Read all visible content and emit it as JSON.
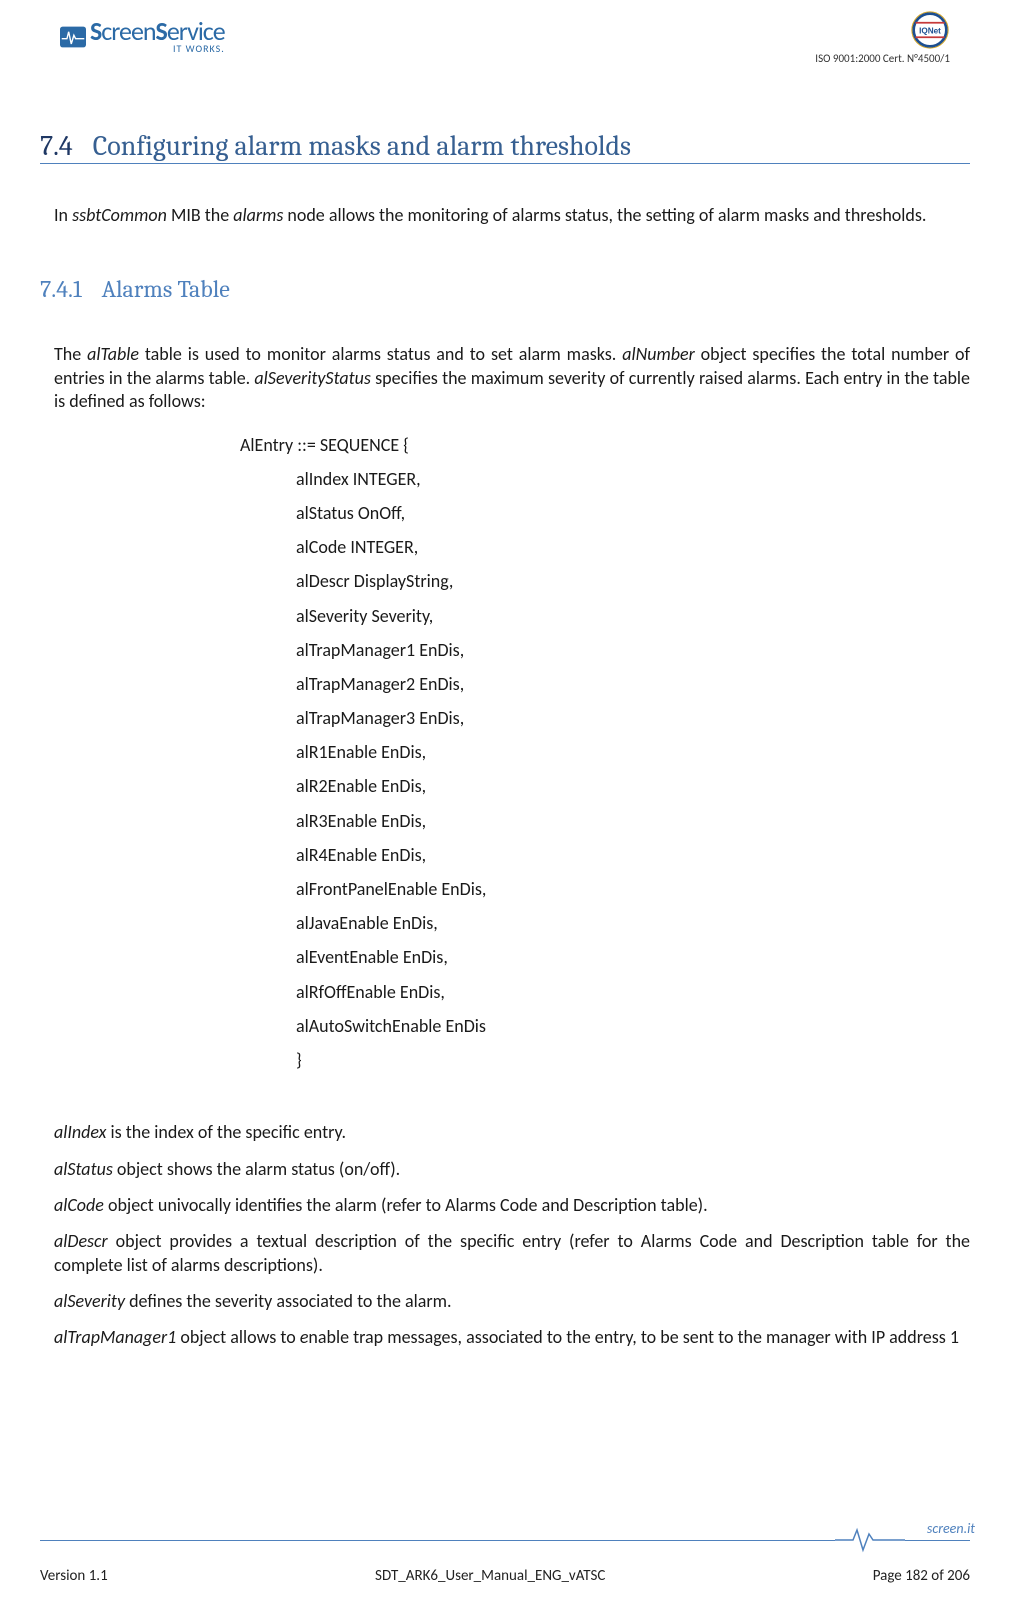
{
  "header": {
    "company_logo_main": "ScreenService",
    "company_logo_sub": "IT WORKS.",
    "cert_line": "ISO 9001:2000 Cert. N°4500/1",
    "iqnet_label": "IQNet"
  },
  "section": {
    "num_7_4": "7.4",
    "title_7_4": "Configuring alarm masks and alarm thresholds",
    "num_7_4_1": "7.4.1",
    "title_7_4_1": "Alarms Table"
  },
  "paragraphs": {
    "p1_pre": "In ",
    "p1_i1": "ssbtCommon",
    "p1_mid1": " MIB the ",
    "p1_i2": "alarms",
    "p1_post": " node allows the monitoring of alarms status, the setting of alarm masks and thresholds.",
    "p2_pre": "The ",
    "p2_i1": "alTable",
    "p2_mid1": " table is used to monitor alarms status and to set alarm masks. ",
    "p2_i2": "alNumber",
    "p2_mid2": " object specifies the total number of entries in the alarms table. ",
    "p2_i3": "alSeverityStatus",
    "p2_post": " specifies the maximum severity of currently raised alarms. Each entry in the table is defined as follows:"
  },
  "sequence": {
    "header": "AlEntry ::= SEQUENCE {",
    "lines": [
      "alIndex INTEGER,",
      "alStatus OnOff,",
      "alCode INTEGER,",
      "alDescr DisplayString,",
      "alSeverity Severity,",
      "alTrapManager1 EnDis,",
      "alTrapManager2 EnDis,",
      "alTrapManager3 EnDis,",
      "alR1Enable EnDis,",
      "alR2Enable EnDis,",
      "alR3Enable EnDis,",
      "alR4Enable EnDis,",
      "alFrontPanelEnable EnDis,",
      "alJavaEnable EnDis,",
      "alEventEnable EnDis,",
      "alRfOffEnable EnDis,",
      "alAutoSwitchEnable EnDis"
    ],
    "close": "}"
  },
  "defs": {
    "d1_i": "alIndex",
    "d1_t": " is the index of the specific entry.",
    "d2_i": "alStatus",
    "d2_t": " object shows the alarm status (on/off).",
    "d3_i": "alCode",
    "d3_t": " object univocally identifies the alarm (refer to Alarms Code and Description table).",
    "d4_i": "alDescr",
    "d4_t": " object provides a textual description of the specific entry (refer to Alarms Code and Description table for the complete list of alarms descriptions).",
    "d5_i": "alSeverity",
    "d5_t": " defines the severity associated to the alarm.",
    "d6_i": "alTrapManager1",
    "d6_t_pre": " object allows to ",
    "d6_t_ei": "e",
    "d6_t_post": "nable trap messages, associated to the entry, to be sent to the manager with IP address 1"
  },
  "footer": {
    "version": "Version 1.1",
    "docname": "SDT_ARK6_User_Manual_ENG_vATSC",
    "page": "Page 182 of 206",
    "brand": "screen.it"
  }
}
